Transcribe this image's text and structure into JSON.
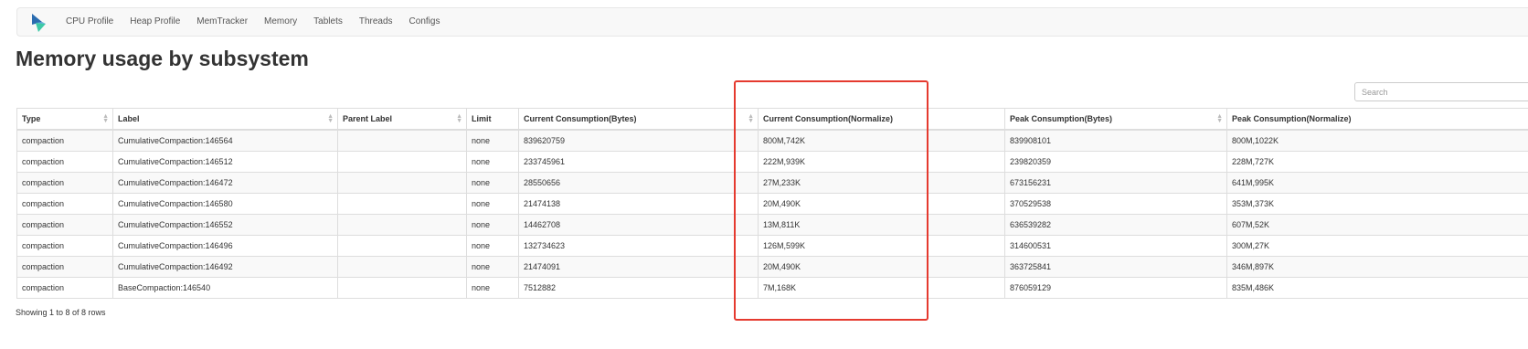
{
  "nav": {
    "items": [
      "CPU Profile",
      "Heap Profile",
      "MemTracker",
      "Memory",
      "Tablets",
      "Threads",
      "Configs"
    ]
  },
  "page": {
    "title": "Memory usage by subsystem"
  },
  "search": {
    "placeholder": "Search"
  },
  "table": {
    "columns": [
      "Type",
      "Label",
      "Parent Label",
      "Limit",
      "Current Consumption(Bytes)",
      "Current Consumption(Normalize)",
      "Peak Consumption(Bytes)",
      "Peak Consumption(Normalize)"
    ],
    "rows": [
      [
        "compaction",
        "CumulativeCompaction:146564",
        "",
        "none",
        "839620759",
        "800M,742K",
        "839908101",
        "800M,1022K"
      ],
      [
        "compaction",
        "CumulativeCompaction:146512",
        "",
        "none",
        "233745961",
        "222M,939K",
        "239820359",
        "228M,727K"
      ],
      [
        "compaction",
        "CumulativeCompaction:146472",
        "",
        "none",
        "28550656",
        "27M,233K",
        "673156231",
        "641M,995K"
      ],
      [
        "compaction",
        "CumulativeCompaction:146580",
        "",
        "none",
        "21474138",
        "20M,490K",
        "370529538",
        "353M,373K"
      ],
      [
        "compaction",
        "CumulativeCompaction:146552",
        "",
        "none",
        "14462708",
        "13M,811K",
        "636539282",
        "607M,52K"
      ],
      [
        "compaction",
        "CumulativeCompaction:146496",
        "",
        "none",
        "132734623",
        "126M,599K",
        "314600531",
        "300M,27K"
      ],
      [
        "compaction",
        "CumulativeCompaction:146492",
        "",
        "none",
        "21474091",
        "20M,490K",
        "363725841",
        "346M,897K"
      ],
      [
        "compaction",
        "BaseCompaction:146540",
        "",
        "none",
        "7512882",
        "7M,168K",
        "876059129",
        "835M,486K"
      ]
    ]
  },
  "footer": {
    "text": "Showing 1 to 8 of 8 rows"
  },
  "colors": {
    "highlight": "#e53a2f",
    "logo_blue": "#2b6cb0",
    "logo_teal": "#3ec9a7"
  }
}
